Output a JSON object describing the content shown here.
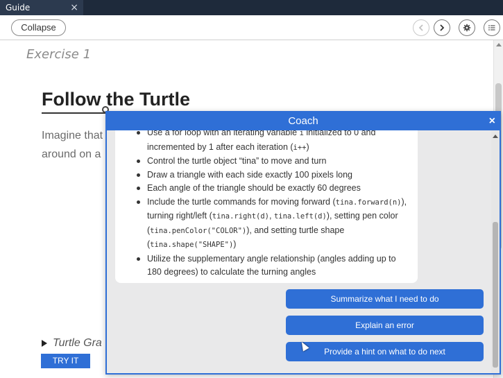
{
  "tab": {
    "title": "Guide",
    "close": "×"
  },
  "toolbar": {
    "collapse_label": "Collapse"
  },
  "guide": {
    "exercise": "Exercise 1",
    "title": "Follow the Turtle",
    "paragraph_line1": "Imagine that",
    "paragraph_line2": "around on a",
    "details_label": "Turtle Gra",
    "try_label": "TRY IT"
  },
  "coach": {
    "title": "Coach",
    "close": "×",
    "bullets": [
      {
        "parts": [
          {
            "t": "Use a for loop with an iterating variable "
          },
          {
            "c": "i"
          },
          {
            "t": " initialized to 0 and incremented by 1 after each iteration ("
          },
          {
            "c": "i++"
          },
          {
            "t": ")"
          }
        ]
      },
      {
        "parts": [
          {
            "t": "Control the turtle object “tina” to move and turn"
          }
        ]
      },
      {
        "parts": [
          {
            "t": "Draw a triangle with each side exactly 100 pixels long"
          }
        ]
      },
      {
        "parts": [
          {
            "t": "Each angle of the triangle should be exactly 60 degrees"
          }
        ]
      },
      {
        "parts": [
          {
            "t": "Include the turtle commands for moving forward ("
          },
          {
            "c": "tina.forward(n)"
          },
          {
            "t": "), turning right/left ("
          },
          {
            "c": "tina.right(d)"
          },
          {
            "t": ", "
          },
          {
            "c": "tina.left(d)"
          },
          {
            "t": "), setting pen color ("
          },
          {
            "c": "tina.penColor(\"COLOR\")"
          },
          {
            "t": "), and setting turtle shape ("
          },
          {
            "c": "tina.shape(\"SHAPE\")"
          },
          {
            "t": ")"
          }
        ]
      },
      {
        "parts": [
          {
            "t": "Utilize the supplementary angle relationship (angles adding up to 180 degrees) to calculate the turning angles"
          }
        ]
      }
    ],
    "actions": [
      "Summarize what I need to do",
      "Explain an error",
      "Provide a hint on what to do next"
    ]
  },
  "colors": {
    "accent": "#2f6fd6",
    "tabbar": "#1e2a3b"
  }
}
